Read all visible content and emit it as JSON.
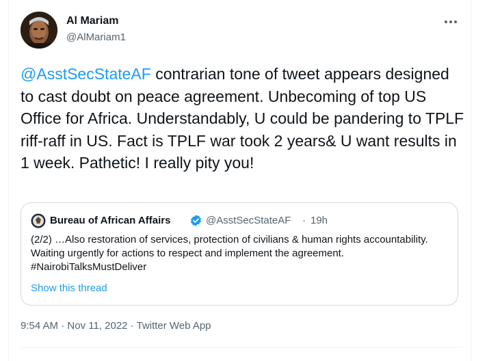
{
  "author": {
    "name": "Al Mariam",
    "handle": "@AlMariam1"
  },
  "tweet": {
    "mention": "@AsstSecStateAF",
    "text": " contrarian tone of tweet appears designed to cast doubt on peace agreement. Unbecoming of top US Office for Africa. Understandably, U could be pandering to TPLF riff-raff in US. Fact is TPLF war took 2 years& U want results in 1 week. Pathetic! I really pity you!"
  },
  "quoted_tweet": {
    "name": "Bureau of African Affairs",
    "handle": "@AsstSecStateAF",
    "separator": "·",
    "time": "19h",
    "text": "(2/2) …Also restoration of services, protection of civilians & human rights accountability.  Waiting urgently for actions to respect and implement the agreement.  #NairobiTalksMustDeliver",
    "show_thread": "Show this thread"
  },
  "meta": {
    "time": "9:54 AM",
    "sep1": " · ",
    "date": "Nov 11, 2022",
    "sep2": " · ",
    "source": "Twitter Web App"
  },
  "colors": {
    "accent": "#1d9bf0",
    "text": "#0f1419",
    "secondary": "#536471",
    "border": "#cfd9de"
  },
  "icons": [
    "more-icon",
    "verified-badge-icon",
    "state-department-seal-icon"
  ]
}
